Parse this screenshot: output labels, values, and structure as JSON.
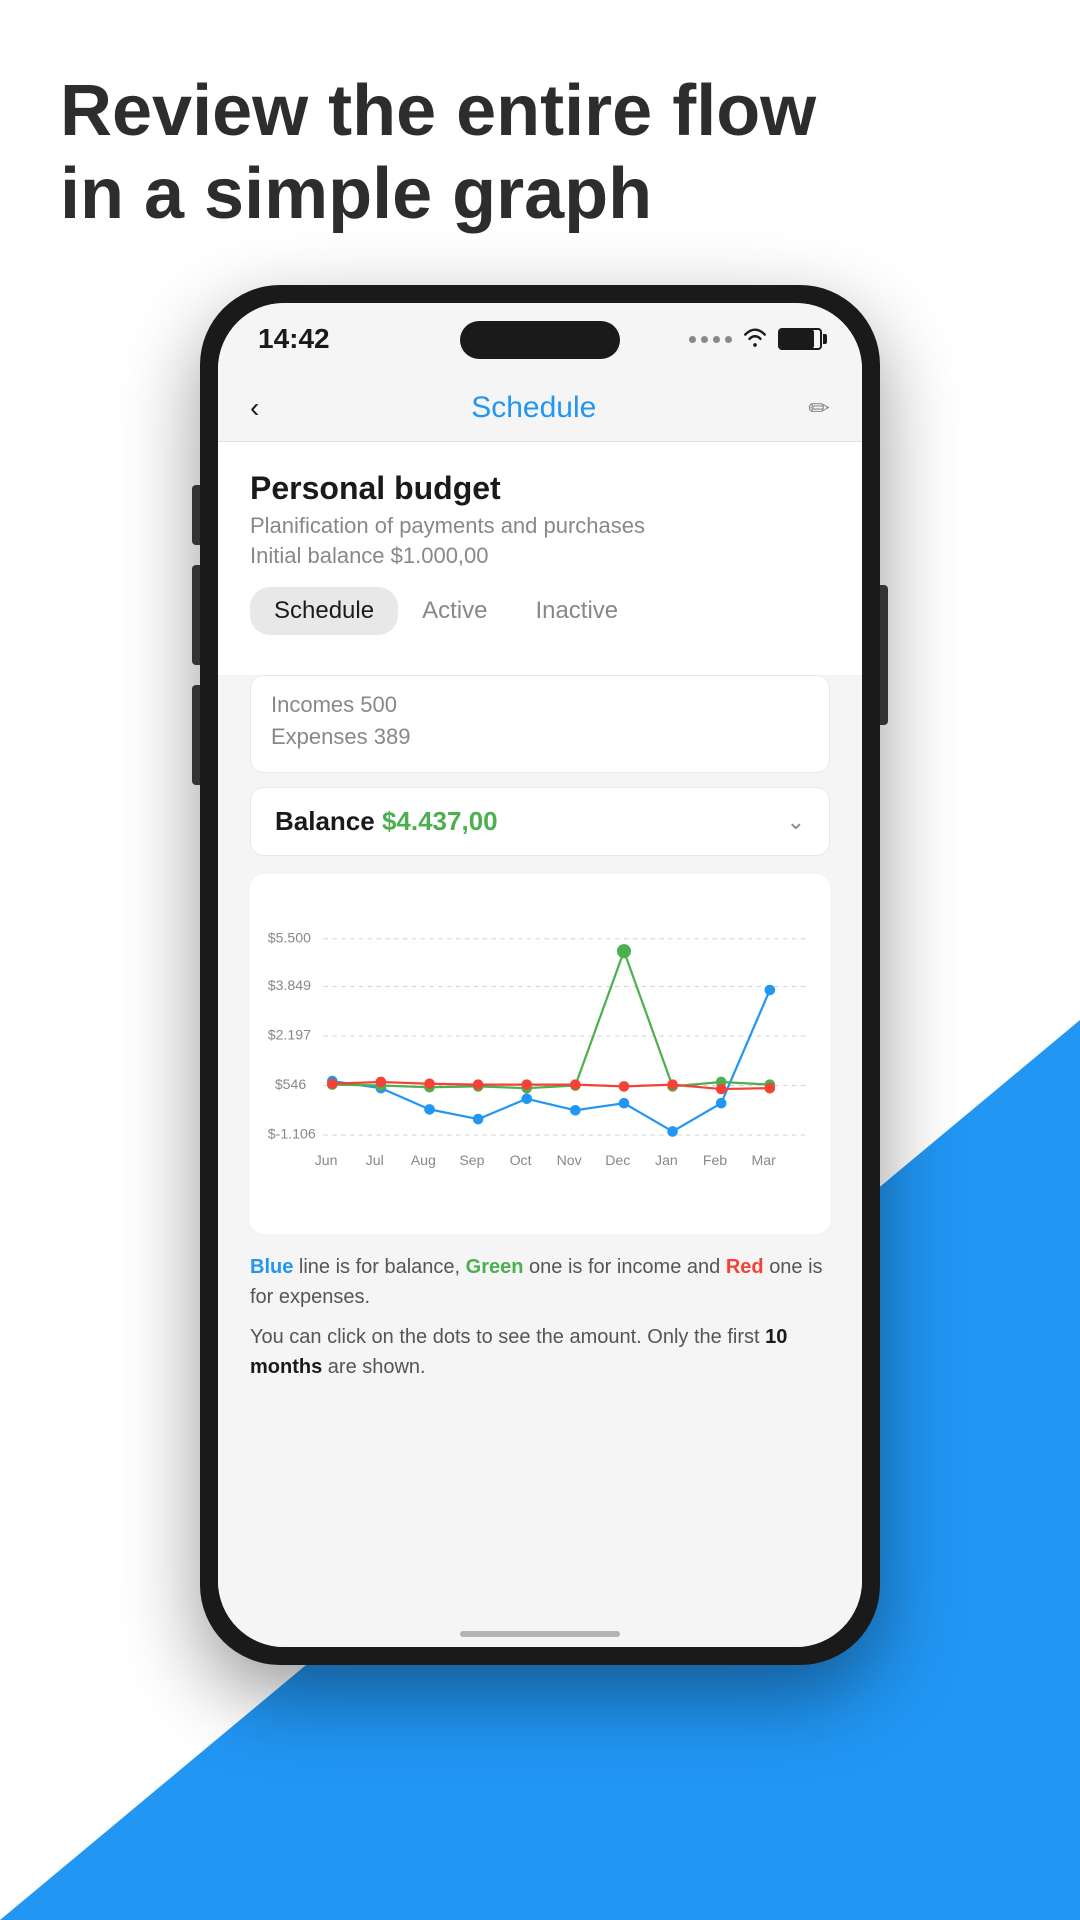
{
  "page": {
    "title_line1": "Review the entire flow",
    "title_line2": "in a simple graph"
  },
  "status_bar": {
    "time": "14:42"
  },
  "nav": {
    "back_icon": "‹",
    "title": "Schedule",
    "edit_icon": "✏"
  },
  "budget": {
    "title": "Personal budget",
    "subtitle": "Planification of payments and purchases",
    "initial_balance": "Initial balance $1.000,00"
  },
  "tabs": [
    {
      "label": "Schedule",
      "active": true
    },
    {
      "label": "Active",
      "active": false
    },
    {
      "label": "Inactive",
      "active": false
    }
  ],
  "summary": {
    "incomes_label": "Incomes 500",
    "expenses_label": "Expenses 389"
  },
  "balance_row": {
    "label": "Balance",
    "value": "$4.437,00"
  },
  "chart": {
    "y_labels": [
      "$5.500",
      "$3.849",
      "$2.197",
      "$546",
      "$-1.106"
    ],
    "x_labels": [
      "Jun",
      "Jul",
      "Aug",
      "Sep",
      "Oct",
      "Nov",
      "Dec",
      "Jan",
      "Feb",
      "Mar"
    ],
    "colors": {
      "blue": "#2196F3",
      "green": "#4CAF50",
      "red": "#f44336"
    }
  },
  "legend": {
    "line1_prefix": "",
    "blue_label": "Blue",
    "line1_mid": " line is for balance, ",
    "green_label": "Green",
    "line1_mid2": " one is for income and ",
    "red_label": "Red",
    "line1_suffix": " one is for expenses.",
    "line2": "You can click on the dots to see the amount. Only the first ",
    "line2_bold": "10 months",
    "line2_suffix": " are shown."
  }
}
